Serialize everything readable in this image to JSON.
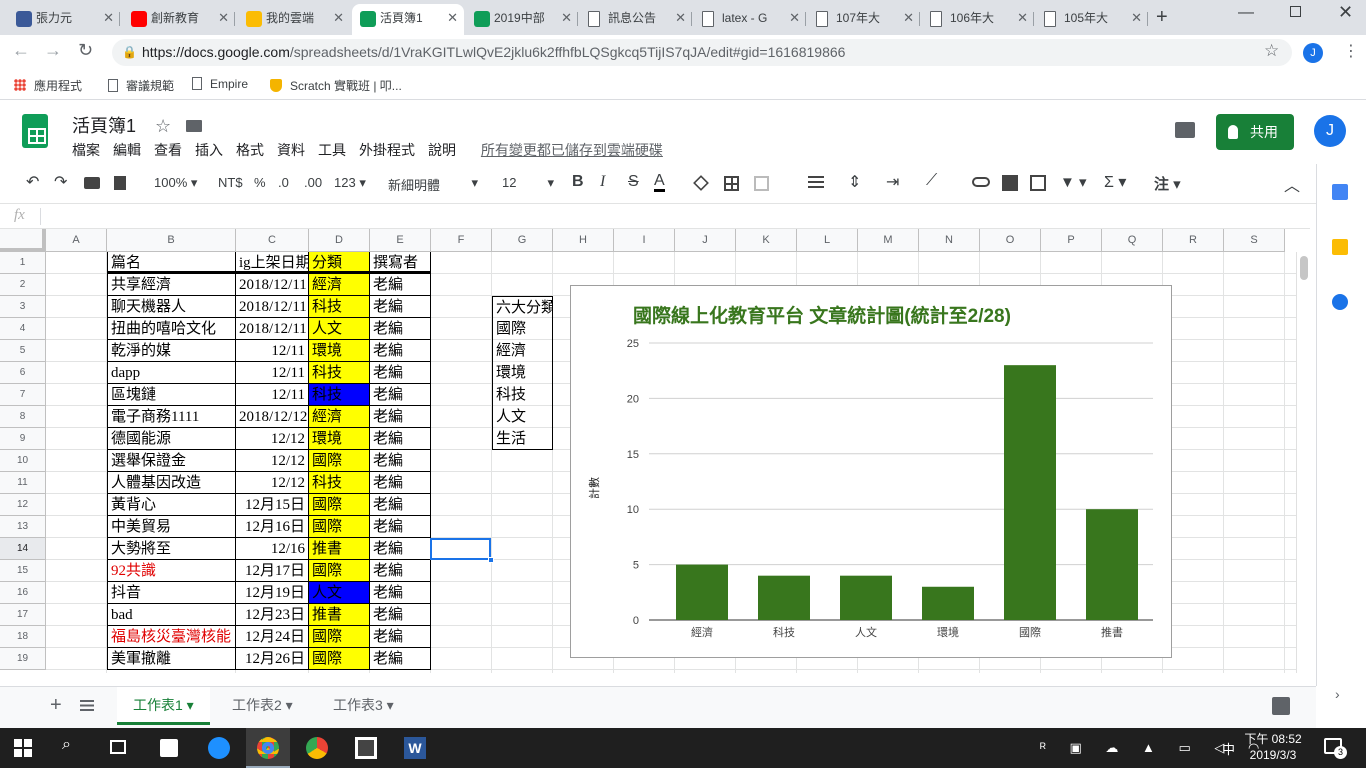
{
  "browser": {
    "tabs": [
      {
        "label": "張力元",
        "color": "#3b5998"
      },
      {
        "label": "創新教育",
        "color": "#ff0000"
      },
      {
        "label": "我的雲端",
        "color": "#fbbc04"
      },
      {
        "label": "活頁簿1",
        "color": "#0f9d58"
      },
      {
        "label": "2019中部",
        "color": "#0f9d58"
      },
      {
        "label": "訊息公告",
        "color": "#ffffff"
      },
      {
        "label": "latex - G",
        "color": "#ffffff"
      },
      {
        "label": "107年大",
        "color": "#ffffff"
      },
      {
        "label": "106年大",
        "color": "#ffffff"
      },
      {
        "label": "105年大",
        "color": "#ffffff"
      }
    ],
    "url_host": "https://docs.google.com",
    "url_path": "/spreadsheets/d/1VraKGITLwlQvE2jklu6k2ffhfbLQSgkcq5TijIS7qJA/edit#gid=1616819866",
    "profile_initial": "J",
    "bookmarks": [
      "應用程式",
      "審議規範",
      "Empire",
      "Scratch 實戰班 | 叩..."
    ]
  },
  "app": {
    "title": "活頁簿1",
    "menus": [
      "檔案",
      "編輯",
      "查看",
      "插入",
      "格式",
      "資料",
      "工具",
      "外掛程式",
      "說明"
    ],
    "saved_status": "所有變更都已儲存到雲端硬碟",
    "share_label": "共用",
    "avatar_initial": "J",
    "accent": "#188038"
  },
  "toolbar": {
    "zoom": "100%",
    "currency": "NT$",
    "percent": "%",
    "dec_less": ".0",
    "dec_more": ".00",
    "format": "123",
    "font": "新細明體",
    "font_size": "12",
    "bold": "B",
    "italic": "I",
    "strike": "S",
    "text_color": "A",
    "sigma": "Σ",
    "note": "注"
  },
  "formula_bar": {
    "fx": "fx",
    "value": ""
  },
  "grid": {
    "columns": [
      "A",
      "B",
      "C",
      "D",
      "E",
      "F",
      "G",
      "H",
      "I",
      "J",
      "K",
      "L",
      "M",
      "N",
      "O",
      "P",
      "Q",
      "R",
      "S"
    ],
    "rows": [
      "1",
      "2",
      "3",
      "4",
      "5",
      "6",
      "7",
      "8",
      "9",
      "10",
      "11",
      "12",
      "13",
      "14",
      "15",
      "16",
      "17",
      "18",
      "19"
    ],
    "header": [
      "篇名",
      "ig上架日期",
      "分類",
      "撰寫者"
    ],
    "data": [
      [
        "共享經濟",
        "2018/12/11",
        "經濟",
        "老編",
        "yellow",
        ""
      ],
      [
        "聊天機器人",
        "2018/12/11",
        "科技",
        "老編",
        "yellow",
        ""
      ],
      [
        "扭曲的嘻哈文化",
        "2018/12/11",
        "人文",
        "老編",
        "yellow",
        ""
      ],
      [
        "乾淨的媒",
        "12/11",
        "環境",
        "老編",
        "yellow",
        ""
      ],
      [
        "dapp",
        "12/11",
        "科技",
        "老編",
        "yellow",
        ""
      ],
      [
        "區塊鏈",
        "12/11",
        "科技",
        "老編",
        "blue",
        ""
      ],
      [
        "電子商務1111",
        "2018/12/12",
        "經濟",
        "老編",
        "yellow",
        ""
      ],
      [
        "德國能源",
        "12/12",
        "環境",
        "老編",
        "yellow",
        ""
      ],
      [
        "選舉保證金",
        "12/12",
        "國際",
        "老編",
        "yellow",
        ""
      ],
      [
        "人體基因改造",
        "12/12",
        "科技",
        "老編",
        "yellow",
        ""
      ],
      [
        "黃背心",
        "12月15日",
        "國際",
        "老編",
        "yellow",
        ""
      ],
      [
        "中美貿易",
        "12月16日",
        "國際",
        "老編",
        "yellow",
        ""
      ],
      [
        "大勢將至",
        "12/16",
        "推書",
        "老編",
        "yellow",
        ""
      ],
      [
        "92共識",
        "12月17日",
        "國際",
        "老編",
        "yellow",
        "red"
      ],
      [
        "抖音",
        "12月19日",
        "人文",
        "老編",
        "blue",
        ""
      ],
      [
        "bad",
        "12月23日",
        "推書",
        "老編",
        "yellow",
        ""
      ],
      [
        "福島核災臺灣核能",
        "12月24日",
        "國際",
        "老編",
        "yellow",
        "red"
      ],
      [
        "美軍撤離",
        "12月26日",
        "國際",
        "老編",
        "yellow",
        ""
      ]
    ],
    "categories_box": [
      "六大分類",
      "國際",
      "經濟",
      "環境",
      "科技",
      "人文",
      "生活"
    ]
  },
  "chart_data": {
    "type": "bar",
    "title": "國際線上化教育平台 文章統計圖(統計至2/28)",
    "categories": [
      "經濟",
      "科技",
      "人文",
      "環境",
      "國際",
      "推書"
    ],
    "values": [
      5,
      4,
      4,
      3,
      23,
      10
    ],
    "ylabel": "計數",
    "xlabel": "",
    "ylim": [
      0,
      25
    ],
    "yticks": [
      "0",
      "5",
      "10",
      "15",
      "20",
      "25"
    ],
    "bar_color": "#38761d",
    "title_color": "#38761d",
    "grid": true
  },
  "sheets": {
    "tabs": [
      "工作表1",
      "工作表2",
      "工作表3"
    ],
    "active": 0
  },
  "taskbar": {
    "time": "下午 08:52",
    "date": "2019/3/3",
    "ime": "中",
    "notif": "3"
  }
}
